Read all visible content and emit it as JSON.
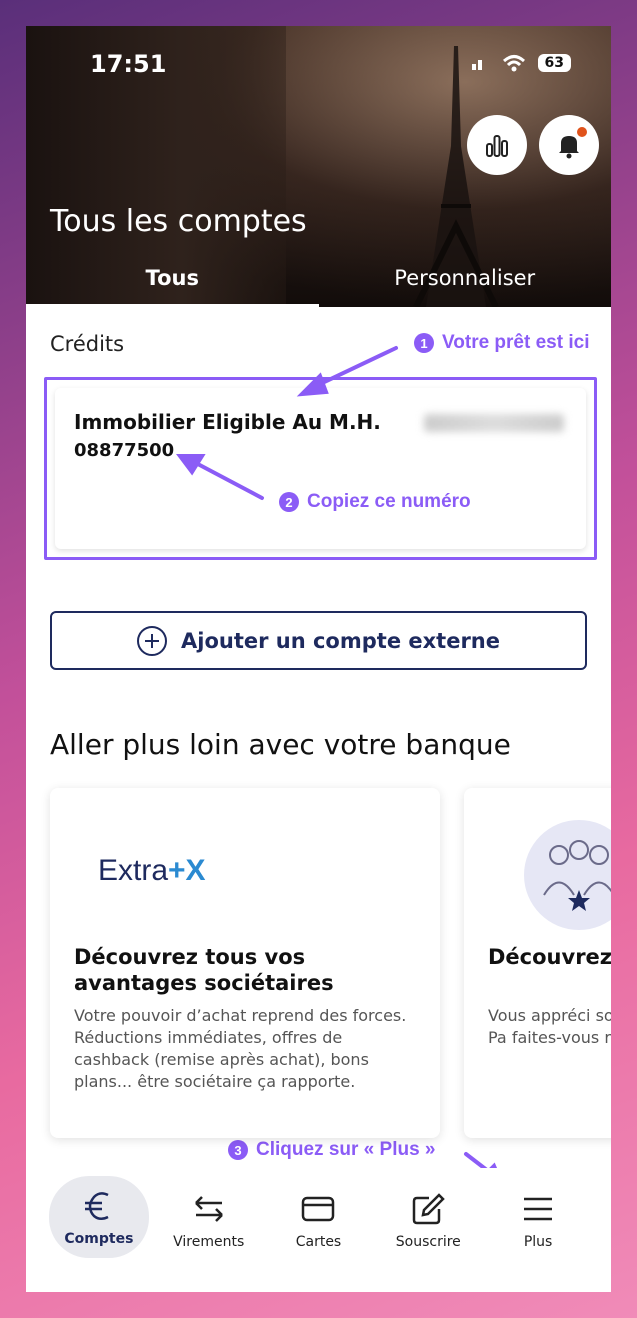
{
  "status": {
    "time": "17:51",
    "battery": "63"
  },
  "header": {
    "title": "Tous les comptes",
    "tabs": [
      {
        "label": "Tous"
      },
      {
        "label": "Personnaliser"
      }
    ]
  },
  "credits": {
    "section_label": "Crédits",
    "account_name": "Immobilier Eligible Au M.H.",
    "account_number": "08877500"
  },
  "annotations": {
    "a1": {
      "num": "1",
      "text": "Votre prêt est ici"
    },
    "a2": {
      "num": "2",
      "text": "Copiez ce numéro"
    },
    "a3": {
      "num": "3",
      "text": "Cliquez sur « Plus »"
    }
  },
  "add_external": {
    "label": "Ajouter un compte externe"
  },
  "promo_section": {
    "title": "Aller plus loin avec votre banque",
    "cards": [
      {
        "logo_text": "Extra",
        "logo_accent": "+X",
        "title": "Découvrez tous vos avantages sociétaires",
        "text": "Votre pouvoir d’achat reprend des forces. Réductions immédiates, offres de cashback (remise après achat), bons plans... être sociétaire ça rapporte."
      },
      {
        "title": "Découvrez parrainage",
        "text": "Vous appréci souhaitez en f entourage ? Pa faites-vous réc soumise à con"
      }
    ]
  },
  "nav": {
    "items": [
      {
        "label": "Comptes",
        "icon": "euro-icon"
      },
      {
        "label": "Virements",
        "icon": "transfer-icon"
      },
      {
        "label": "Cartes",
        "icon": "card-icon"
      },
      {
        "label": "Souscrire",
        "icon": "edit-icon"
      },
      {
        "label": "Plus",
        "icon": "menu-icon"
      }
    ]
  },
  "colors": {
    "annotation": "#8b5cf6",
    "brand_navy": "#1e2a5e",
    "notification_dot": "#e0531c"
  }
}
